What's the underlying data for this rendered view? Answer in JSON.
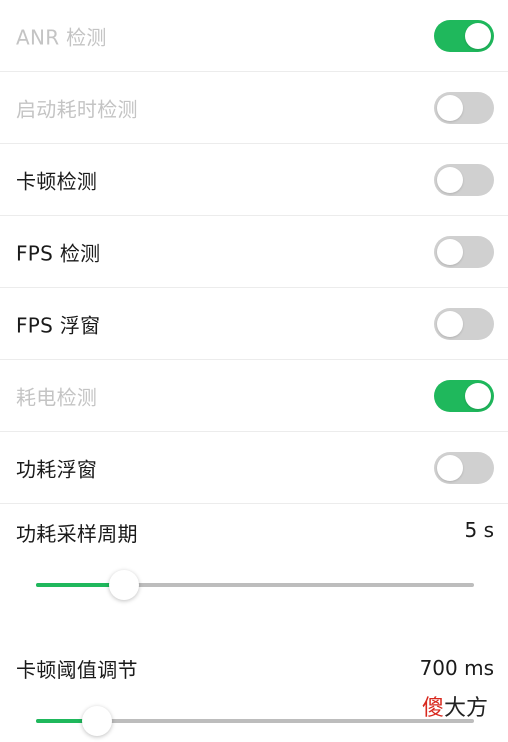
{
  "settings": [
    {
      "label": "ANR 检测",
      "enabled": true,
      "disabled": true
    },
    {
      "label": "启动耗时检测",
      "enabled": false,
      "disabled": true
    },
    {
      "label": "卡顿检测",
      "enabled": false,
      "disabled": false
    },
    {
      "label": "FPS 检测",
      "enabled": false,
      "disabled": false
    },
    {
      "label": "FPS 浮窗",
      "enabled": false,
      "disabled": false
    },
    {
      "label": "耗电检测",
      "enabled": true,
      "disabled": true
    },
    {
      "label": "功耗浮窗",
      "enabled": false,
      "disabled": false
    }
  ],
  "sample_period": {
    "title": "功耗采样周期",
    "value_text": "5 s",
    "fraction": 0.2
  },
  "jank_threshold": {
    "title": "卡顿阈值调节",
    "value_text": "700 ms",
    "fraction": 0.14
  },
  "watermark": {
    "part_a": "傻",
    "part_b": "大方"
  },
  "colors": {
    "accent": "#1fb85c",
    "toggle_off": "#d0d0d0",
    "disabled_text": "#c4c4c4"
  }
}
